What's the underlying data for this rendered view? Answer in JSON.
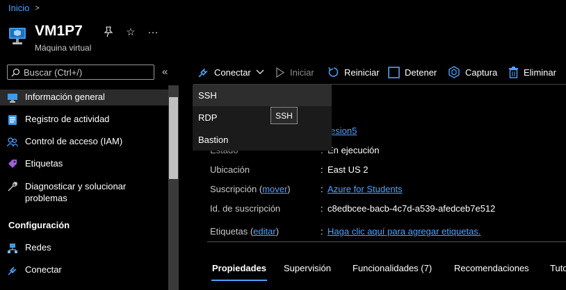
{
  "breadcrumb": {
    "items": [
      "Inicio"
    ],
    "separator": ">"
  },
  "header": {
    "title": "VM1P7",
    "subtitle": "Máquina virtual",
    "pin_glyph": "⚲",
    "favorite_glyph": "☆",
    "more_glyph": "···"
  },
  "search": {
    "placeholder": "Buscar (Ctrl+/)",
    "value": ""
  },
  "sidebar": {
    "collapse_glyph": "«",
    "items": [
      {
        "label": "Información general",
        "icon": "monitor-icon",
        "selected": true
      },
      {
        "label": "Registro de actividad",
        "icon": "log-icon"
      },
      {
        "label": "Control de acceso (IAM)",
        "icon": "people-icon"
      },
      {
        "label": "Etiquetas",
        "icon": "tag-icon"
      },
      {
        "label": "Diagnosticar y solucionar problemas",
        "icon": "wrench-icon"
      }
    ],
    "section_configuracion": "Configuración",
    "config_items": [
      {
        "label": "Redes",
        "icon": "network-icon"
      },
      {
        "label": "Conectar",
        "icon": "plug-icon"
      }
    ]
  },
  "toolbar": {
    "conectar": "Conectar",
    "iniciar": "Iniciar",
    "reiniciar": "Reiniciar",
    "detener": "Detener",
    "captura": "Captura",
    "eliminar": "Eliminar"
  },
  "connect_menu": {
    "items": [
      "SSH",
      "RDP",
      "Bastion"
    ],
    "tooltip": "SSH"
  },
  "essentials": {
    "partial_link": "esion5",
    "estado_label": "Estado",
    "estado_value": "En ejecución",
    "ubicacion_label": "Ubicación",
    "ubicacion_value": "East US 2",
    "suscripcion_label": "Suscripción",
    "mover_link": "mover",
    "suscripcion_value": "Azure for Students",
    "id_label": "Id. de suscripción",
    "id_value": "c8edbcee-bacb-4c7d-a539-afedceb7e512",
    "etiquetas_label": "Etiquetas",
    "editar_link": "editar",
    "etiquetas_value": "Haga clic aquí para agregar etiquetas."
  },
  "tabs": [
    "Propiedades",
    "Supervisión",
    "Funcionalidades (7)",
    "Recomendaciones",
    "Tuto"
  ],
  "colors": {
    "accent": "#4da3ff",
    "background": "#000000",
    "sidebar_selected": "#2b2b2b",
    "menu_bg": "#1b1b1b"
  }
}
